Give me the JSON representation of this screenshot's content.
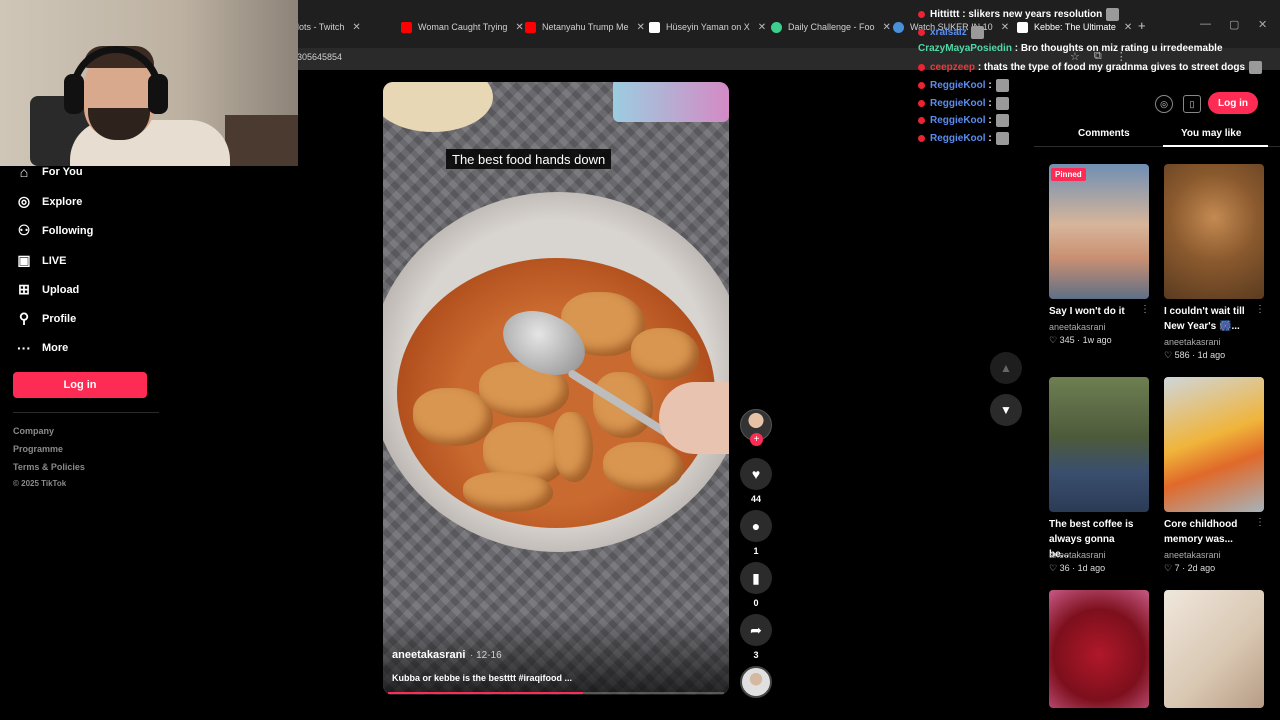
{
  "browser": {
    "tabs": [
      {
        "label": "lots - Twitch",
        "color": "#9146ff"
      },
      {
        "label": "Woman Caught Trying",
        "color": "#ff0000"
      },
      {
        "label": "Netanyahu Trump Me",
        "color": "#ff0000"
      },
      {
        "label": "Hüseyin Yaman on X",
        "color": "#ffffff"
      },
      {
        "label": "Daily Challenge - Foo",
        "color": "#3ecf8e"
      },
      {
        "label": "Watch SUKER IN 10",
        "color": "#4a90d9"
      },
      {
        "label": "Kebbe: The Ultimate",
        "color": "#ffffff"
      }
    ],
    "address_fragment": "305645854",
    "new_tab_label": "+",
    "window_controls": [
      "—",
      "▢",
      "✕"
    ]
  },
  "chat": [
    {
      "user": "Hittittt",
      "text": ": slikers new years resolution",
      "color": "#ffffff",
      "badge": true
    },
    {
      "user": "xralsalz",
      "text": "",
      "color": "#5b8def",
      "badge": true
    },
    {
      "user": "CrazyMayaPosiedin",
      "text": ": Bro thoughts on miz rating u irredeemable",
      "color": "#4fd8a6",
      "badge": false
    },
    {
      "user": "ceepzeep",
      "text": ": thats the type of food my gradnma gives to street dogs",
      "color": "#e03e3e",
      "badge": true
    },
    {
      "user": "ReggieKool",
      "text": ":",
      "color": "#5b8def",
      "badge": true
    },
    {
      "user": "ReggieKool",
      "text": ":",
      "color": "#5b8def",
      "badge": true
    },
    {
      "user": "ReggieKool",
      "text": ":",
      "color": "#5b8def",
      "badge": true
    },
    {
      "user": "ReggieKool",
      "text": ":",
      "color": "#5b8def",
      "badge": true
    }
  ],
  "sidebar": {
    "items": [
      {
        "label": "For You",
        "icon": "home-icon"
      },
      {
        "label": "Explore",
        "icon": "compass-icon"
      },
      {
        "label": "Following",
        "icon": "person-icon"
      },
      {
        "label": "LIVE",
        "icon": "live-icon"
      },
      {
        "label": "Upload",
        "icon": "plus-square-icon"
      },
      {
        "label": "Profile",
        "icon": "person-icon"
      },
      {
        "label": "More",
        "icon": "more-icon"
      }
    ],
    "login_label": "Log in",
    "footer": [
      "Company",
      "Programme",
      "Terms & Policies"
    ],
    "copyright": "© 2025 TikTok"
  },
  "video": {
    "caption_overlay": "The best food hands down",
    "author": "aneetakasrani",
    "date": "· 12-16",
    "description": "Kubba or kebbe is the bestttt #iraqifood ...",
    "progress": 0.58
  },
  "actions": {
    "likes": "44",
    "comments": "1",
    "saves": "0",
    "shares": "3"
  },
  "right_panel": {
    "login_label": "Log in",
    "tabs": [
      "Comments",
      "You may like"
    ],
    "active_tab": "You may like",
    "pinned_label": "Pinned",
    "cards": [
      {
        "title": "Say I won't do it",
        "author": "aneetakasrani",
        "likes": "345",
        "age": "1w ago"
      },
      {
        "title": "I couldn't wait till New Year's ⁣🎆...",
        "author": "aneetakasrani",
        "likes": "586",
        "age": "1d ago"
      },
      {
        "title": "The best coffee is always gonna be...",
        "author": "aneetakasrani",
        "likes": "36",
        "age": "1d ago"
      },
      {
        "title": "Core childhood memory was...",
        "author": "aneetakasrani",
        "likes": "7",
        "age": "2d ago"
      }
    ]
  }
}
